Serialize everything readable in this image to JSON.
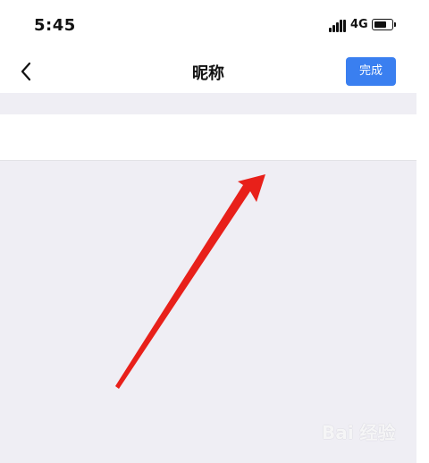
{
  "status_bar": {
    "time": "5:45",
    "network": "4G",
    "battery_level": 0.7
  },
  "nav": {
    "title": "昵称",
    "done_label": "完成",
    "back_icon": "chevron-left-icon"
  },
  "nickname": {
    "value": "",
    "placeholder": ""
  },
  "colors": {
    "accent": "#3a7ff0",
    "background": "#efeef4",
    "annotation_arrow": "#e8201a"
  },
  "watermark": {
    "text": "Bai 经验"
  }
}
